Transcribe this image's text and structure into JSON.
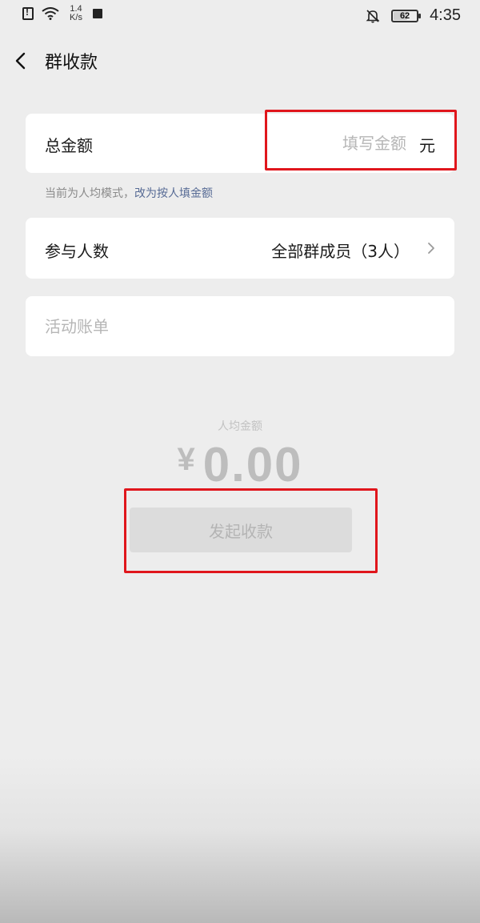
{
  "status_bar": {
    "network_speed_value": "1.4",
    "network_speed_unit": "K/s",
    "battery_level": "62",
    "time": "4:35"
  },
  "header": {
    "title": "群收款"
  },
  "total_amount": {
    "label": "总金额",
    "placeholder": "填写金额",
    "value": "",
    "unit": "元"
  },
  "mode_hint": {
    "text": "当前为人均模式，",
    "link": "改为按人填金额"
  },
  "participants": {
    "label": "参与人数",
    "value": "全部群成员（3人）"
  },
  "bill": {
    "placeholder": "活动账单",
    "value": ""
  },
  "per_person": {
    "label": "人均金额",
    "currency": "¥",
    "amount": "0.00"
  },
  "submit": {
    "label": "发起收款"
  },
  "colors": {
    "background": "#ededed",
    "card": "#ffffff",
    "link": "#576b95",
    "highlight": "#e0161c",
    "disabled_button": "#dcdcdc"
  }
}
